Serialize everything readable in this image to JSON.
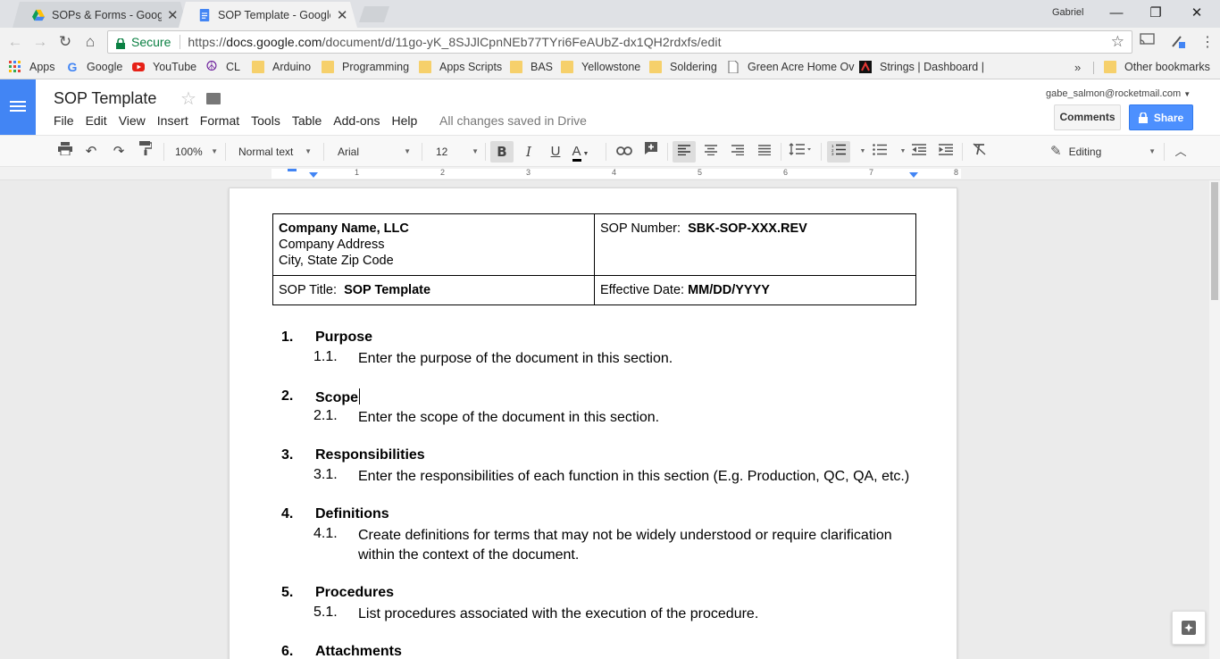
{
  "browser": {
    "tabs": [
      {
        "title": "SOPs & Forms - Google Dr",
        "active": false
      },
      {
        "title": "SOP Template - Google Do",
        "active": true
      }
    ],
    "profile_name": "Gabriel",
    "secure_label": "Secure",
    "url_prefix": "https://",
    "url_host": "docs.google.com",
    "url_path": "/document/d/11go-yK_8SJJlCpnNEb77TYri6FeAUbZ-dx1QH2rdxfs/edit",
    "bookmarks": [
      {
        "label": "Apps",
        "icon": "apps-grid-icon"
      },
      {
        "label": "Google",
        "icon": "google-g-icon"
      },
      {
        "label": "YouTube",
        "icon": "youtube-icon"
      },
      {
        "label": "CL",
        "icon": "peace-sign-icon"
      },
      {
        "label": "Arduino",
        "icon": "folder-icon"
      },
      {
        "label": "Programming",
        "icon": "folder-icon"
      },
      {
        "label": "Apps Scripts",
        "icon": "folder-icon"
      },
      {
        "label": "BAS",
        "icon": "folder-icon"
      },
      {
        "label": "Yellowstone",
        "icon": "folder-icon"
      },
      {
        "label": "Soldering",
        "icon": "folder-icon"
      },
      {
        "label": "Green Acre Home Ov",
        "icon": "page-icon"
      },
      {
        "label": "Strings | Dashboard |",
        "icon": "strings-icon"
      }
    ],
    "bookmarks_overflow": "»",
    "other_bookmarks": "Other bookmarks"
  },
  "docs": {
    "title": "SOP Template",
    "menu": [
      "File",
      "Edit",
      "View",
      "Insert",
      "Format",
      "Tools",
      "Table",
      "Add-ons",
      "Help"
    ],
    "save_status": "All changes saved in Drive",
    "user_email": "gabe_salmon@rocketmail.com",
    "comments_label": "Comments",
    "share_label": "Share",
    "toolbar": {
      "zoom": "100%",
      "style": "Normal text",
      "font": "Arial",
      "size": "12",
      "mode": "Editing"
    },
    "ruler_numbers": [
      "1",
      "2",
      "3",
      "4",
      "5",
      "6",
      "7",
      "8"
    ]
  },
  "document": {
    "header_table": {
      "company_name": "Company  Name, LLC",
      "company_address": "Company Address",
      "city_state_zip": "City, State Zip Code",
      "sop_number_label": "SOP Number:",
      "sop_number_value": "SBK-SOP-XXX.REV",
      "sop_title_label": "SOP Title:",
      "sop_title_value": "SOP Template",
      "effective_date_label": "Effective Date:",
      "effective_date_value": "MM/DD/YYYY"
    },
    "sections": [
      {
        "num": "1.",
        "title": "Purpose",
        "sub_num": "1.1.",
        "sub_text": "Enter the purpose of the document in this section."
      },
      {
        "num": "2.",
        "title": "Scope",
        "sub_num": "2.1.",
        "sub_text": "Enter the scope of the document in this section."
      },
      {
        "num": "3.",
        "title": "Responsibilities",
        "sub_num": "3.1.",
        "sub_text": "Enter the responsibilities of each function in this section (E.g.  Production, QC, QA, etc.)"
      },
      {
        "num": "4.",
        "title": "Definitions",
        "sub_num": "4.1.",
        "sub_text": "Create definitions for terms that may not be widely understood or require clarification within the context of the document."
      },
      {
        "num": "5.",
        "title": "Procedures",
        "sub_num": "5.1.",
        "sub_text": "List procedures associated with the execution of the procedure."
      },
      {
        "num": "6.",
        "title": "Attachments"
      }
    ]
  },
  "colors": {
    "docs_blue": "#4285f4",
    "share_blue": "#4d90fe",
    "secure_green": "#0b8043"
  }
}
